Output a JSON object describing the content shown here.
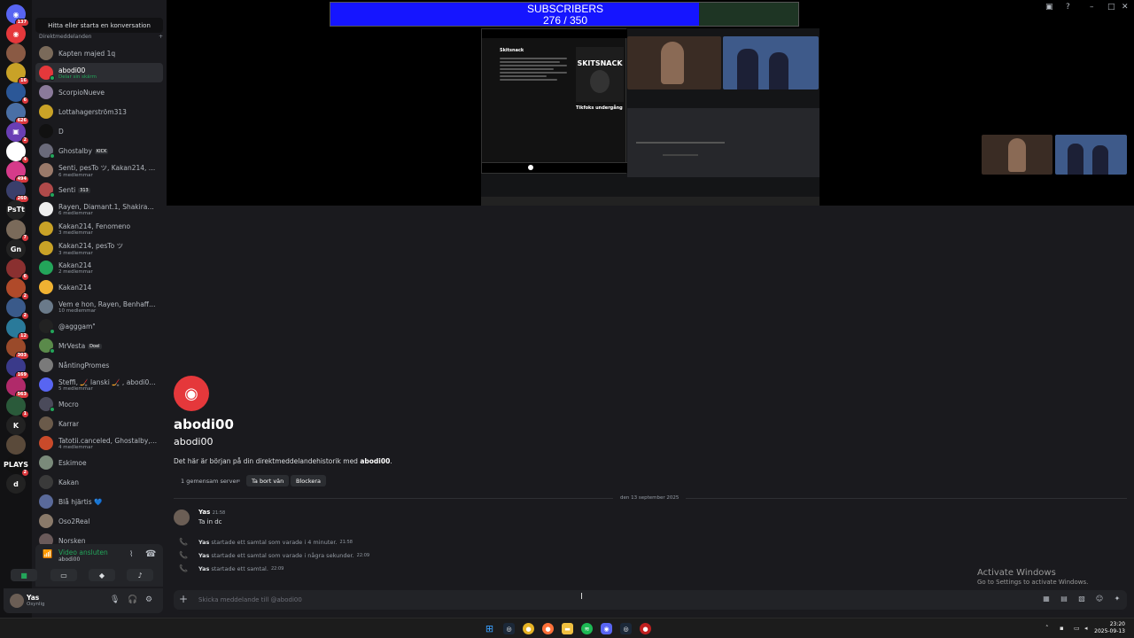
{
  "rail": {
    "servers": [
      {
        "label": "",
        "color": "#5865f2",
        "badge": "137",
        "glyph": "◉"
      },
      {
        "label": "",
        "color": "#e5383b",
        "badge": "",
        "glyph": "◉"
      },
      {
        "label": "",
        "color": "#8a5a44",
        "badge": "",
        "glyph": ""
      },
      {
        "label": "",
        "color": "#c9a227",
        "badge": "16",
        "glyph": ""
      },
      {
        "label": "",
        "color": "#2b5797",
        "badge": "6",
        "glyph": ""
      },
      {
        "label": "",
        "color": "#4a6fa5",
        "badge": "626",
        "glyph": ""
      },
      {
        "label": "",
        "color": "#6a3fb5",
        "badge": "2",
        "glyph": "▣"
      },
      {
        "label": "",
        "color": "#ffffff",
        "badge": "4",
        "glyph": ""
      },
      {
        "label": "",
        "color": "#d63b8a",
        "badge": "494",
        "glyph": ""
      },
      {
        "label": "",
        "color": "#3a3f6b",
        "badge": "260",
        "glyph": ""
      },
      {
        "label": "PsTt",
        "color": "#222222",
        "badge": "",
        "glyph": ""
      },
      {
        "label": "",
        "color": "#7a6a5a",
        "badge": "7",
        "glyph": ""
      },
      {
        "label": "Gn",
        "color": "#222222",
        "badge": "",
        "glyph": ""
      },
      {
        "label": "",
        "color": "#8a3030",
        "badge": "6",
        "glyph": ""
      },
      {
        "label": "",
        "color": "#b04a2a",
        "badge": "2",
        "glyph": ""
      },
      {
        "label": "",
        "color": "#3a5a8a",
        "badge": "2",
        "glyph": ""
      },
      {
        "label": "",
        "color": "#2a7a9a",
        "badge": "12",
        "glyph": ""
      },
      {
        "label": "",
        "color": "#9a4a2a",
        "badge": "303",
        "glyph": ""
      },
      {
        "label": "",
        "color": "#3a3a8a",
        "badge": "169",
        "glyph": ""
      },
      {
        "label": "",
        "color": "#b02a6a",
        "badge": "563",
        "glyph": ""
      },
      {
        "label": "",
        "color": "#2a5a3a",
        "badge": "1",
        "glyph": ""
      },
      {
        "label": "K",
        "color": "#222222",
        "badge": "",
        "glyph": ""
      },
      {
        "label": "",
        "color": "#5a4a3a",
        "badge": "",
        "glyph": ""
      },
      {
        "label": "PLAYS",
        "color": "#111111",
        "badge": "2",
        "glyph": ""
      },
      {
        "label": "d",
        "color": "#222222",
        "badge": "",
        "glyph": ""
      }
    ]
  },
  "dm": {
    "search_label": "Hitta eller starta en konversation",
    "section_label": "Direktmeddelanden",
    "add_glyph": "+",
    "items": [
      {
        "name": "Kapten majed 1q",
        "sub": "",
        "color": "#7a6a5a",
        "status": "",
        "tag": ""
      },
      {
        "name": "abodi00",
        "sub": "Delar sin skärm",
        "color": "#e5383b",
        "status": "#23a55a",
        "tag": ""
      },
      {
        "name": "ScorpioNueve",
        "sub": "",
        "color": "#8a7a9a",
        "status": "",
        "tag": ""
      },
      {
        "name": "Lottahagerström313",
        "sub": "",
        "color": "#c9a227",
        "status": "",
        "tag": ""
      },
      {
        "name": "D",
        "sub": "",
        "color": "#111111",
        "status": "",
        "tag": ""
      },
      {
        "name": "Ghostalby",
        "sub": "",
        "color": "#6a6a7a",
        "status": "#23a55a",
        "tag": "KICK"
      },
      {
        "name": "Senti, pesTo ツ, Kakan214, Sha...",
        "sub": "6 medlemmar",
        "color": "#9a7a6a",
        "status": "",
        "tag": ""
      },
      {
        "name": "Senti",
        "sub": "",
        "color": "#b04a4a",
        "status": "#23a55a",
        "tag": "313"
      },
      {
        "name": "Rayen, Diamant.1, Shakira00.2...",
        "sub": "6 medlemmar",
        "color": "#eeeeee",
        "status": "",
        "tag": ""
      },
      {
        "name": "Kakan214, Fenomeno",
        "sub": "3 medlemmar",
        "color": "#c9a227",
        "status": "",
        "tag": ""
      },
      {
        "name": "Kakan214, pesTo ツ",
        "sub": "3 medlemmar",
        "color": "#c9a227",
        "status": "",
        "tag": ""
      },
      {
        "name": "Kakan214",
        "sub": "2 medlemmar",
        "color": "#23a55a",
        "status": "",
        "tag": ""
      },
      {
        "name": "Kakan214",
        "sub": "",
        "color": "#f0b232",
        "status": "",
        "tag": ""
      },
      {
        "name": "Vem e hon, Rayen, Benhaffa89...",
        "sub": "10 medlemmar",
        "color": "#6a7a8a",
        "status": "",
        "tag": ""
      },
      {
        "name": "@agggam\"",
        "sub": "",
        "color": "#222222",
        "status": "#23a55a",
        "tag": ""
      },
      {
        "name": "MrVesta",
        "sub": "",
        "color": "#5a8a4a",
        "status": "#23a55a",
        "tag": "Doel"
      },
      {
        "name": "NåntingPromes",
        "sub": "",
        "color": "#7a7a7a",
        "status": "",
        "tag": ""
      },
      {
        "name": "Steffi, 🏒 lanski 🏒 , abodi00, ...",
        "sub": "5 medlemmar",
        "color": "#5865f2",
        "status": "",
        "tag": ""
      },
      {
        "name": "Mocro",
        "sub": "",
        "color": "#4a4a5a",
        "status": "#23a55a",
        "tag": ""
      },
      {
        "name": "Karrar",
        "sub": "",
        "color": "#6a5a4a",
        "status": "",
        "tag": ""
      },
      {
        "name": "Tatotii.canceled, Ghostalby, a...",
        "sub": "4 medlemmar",
        "color": "#c94a2a",
        "status": "",
        "tag": ""
      },
      {
        "name": "Eskimoe",
        "sub": "",
        "color": "#7a8a7a",
        "status": "",
        "tag": ""
      },
      {
        "name": "Kakan",
        "sub": "",
        "color": "#3a3a3a",
        "status": "",
        "tag": ""
      },
      {
        "name": "Blå hjärtis 💙",
        "sub": "",
        "color": "#5a6a9a",
        "status": "",
        "tag": ""
      },
      {
        "name": "Oso2Real",
        "sub": "",
        "color": "#8a7a6a",
        "status": "",
        "tag": ""
      },
      {
        "name": "Norsken",
        "sub": "",
        "color": "#6a5a5a",
        "status": "",
        "tag": ""
      }
    ]
  },
  "voice": {
    "title": "Video ansluten",
    "subtitle": "abodi00"
  },
  "user": {
    "name": "Yas",
    "status": "Osynlig"
  },
  "overlay": {
    "label": "SUBSCRIBERS",
    "count_text": "276 / 350",
    "progress_fraction": 0.7886
  },
  "stream": {
    "spotify_title": "Skitsnack",
    "spotify_cover_text": "SKITSNACK",
    "spotify_episode": "Tikfoks undergång"
  },
  "intro": {
    "display_name": "abodi00",
    "username": "abodi00",
    "desc_prefix": "Det här är början på din direktmeddelandehistorik med ",
    "desc_user": "abodi00",
    "desc_suffix": ".",
    "mutual": "1 gemensam server",
    "remove_friend": "Ta bort vän",
    "block": "Blockera"
  },
  "messages": {
    "date_divider": "den 13 september 2025",
    "author": "Yas",
    "time": "21:58",
    "text": "Ta in dc",
    "system": [
      {
        "user": "Yas",
        "text": "startade ett samtal som varade i 4 minuter.",
        "time": "21:58"
      },
      {
        "user": "Yas",
        "text": "startade ett samtal som varade i några sekunder.",
        "time": "22:09"
      },
      {
        "user": "Yas",
        "text": "startade ett samtal.",
        "time": "22:09"
      }
    ]
  },
  "composer": {
    "placeholder": "Skicka meddelande till @abodi00"
  },
  "watermark": {
    "line1": "Activate Windows",
    "line2": "Go to Settings to activate Windows."
  },
  "taskbar": {
    "time": "23:20",
    "date": "2025-09-13"
  }
}
